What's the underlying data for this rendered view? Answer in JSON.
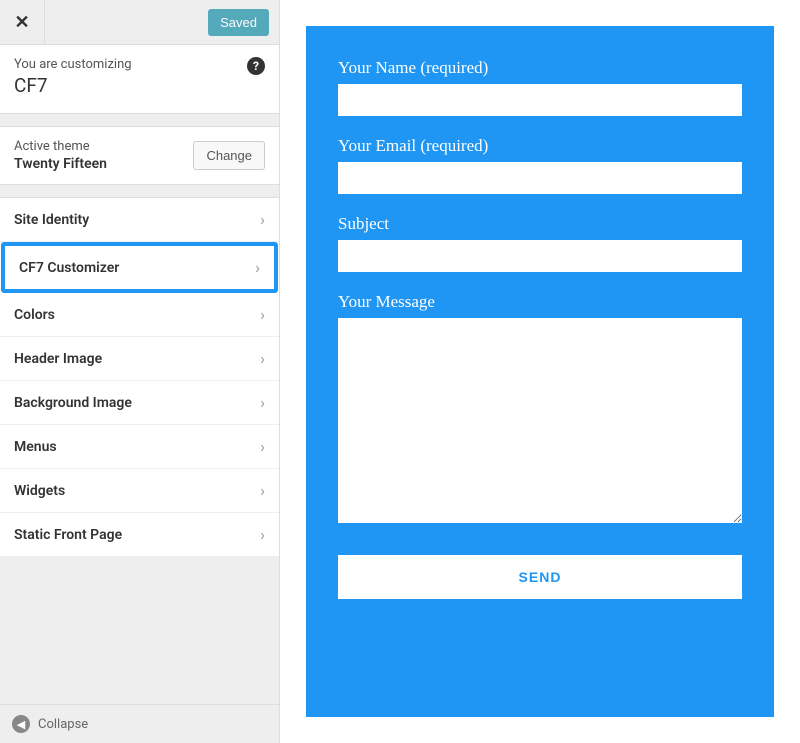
{
  "sidebar": {
    "saved_label": "Saved",
    "customizing_label": "You are customizing",
    "customizing_title": "CF7",
    "theme_label": "Active theme",
    "theme_name": "Twenty Fifteen",
    "change_label": "Change",
    "panels": [
      {
        "label": "Site Identity",
        "highlighted": false
      },
      {
        "label": "CF7 Customizer",
        "highlighted": true
      },
      {
        "label": "Colors",
        "highlighted": false
      },
      {
        "label": "Header Image",
        "highlighted": false
      },
      {
        "label": "Background Image",
        "highlighted": false
      },
      {
        "label": "Menus",
        "highlighted": false
      },
      {
        "label": "Widgets",
        "highlighted": false
      },
      {
        "label": "Static Front Page",
        "highlighted": false
      }
    ],
    "collapse_label": "Collapse"
  },
  "form": {
    "accent_color": "#1f96f3",
    "fields": {
      "name_label": "Your Name (required)",
      "email_label": "Your Email (required)",
      "subject_label": "Subject",
      "message_label": "Your Message"
    },
    "submit_label": "SEND"
  }
}
